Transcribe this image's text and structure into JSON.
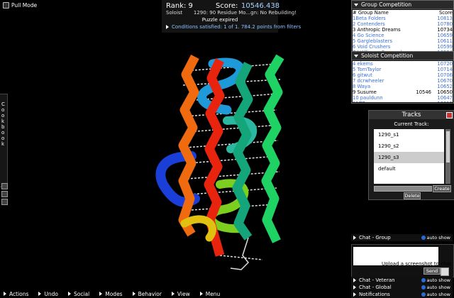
{
  "mode": {
    "label": "Pull Mode",
    "icon": "pull-mode-icon"
  },
  "header": {
    "rank_label": "Rank: 9",
    "score_label": "Score:",
    "score_value": "10546.438",
    "role": "Soloist",
    "puzzle": "1290: 90 Residue Mo...gn: No Rebuilding!",
    "status": "Puzzle expired",
    "conditions": "Conditions satisfied: 1 of 1. 784.2 points from filters"
  },
  "cookbook": {
    "label": "Cookbook"
  },
  "group_competition": {
    "title": "Group Competition",
    "col_name": "# Group Name",
    "col_score": "Score",
    "rows": [
      {
        "name": "1Beta Folders",
        "score": "10813",
        "me": false
      },
      {
        "name": "2 Contenders",
        "score": "10780",
        "me": false
      },
      {
        "name": "3 Anthropic Dreams",
        "score": "10734",
        "me": true
      },
      {
        "name": "4 Go Science",
        "score": "10659",
        "me": false
      },
      {
        "name": "5 Gargleblasters",
        "score": "10611",
        "me": false
      },
      {
        "name": "6 Void Crushers",
        "score": "10599",
        "me": false
      },
      {
        "name": "7 L'Alliance Francopho...",
        "score": "10534",
        "me": false
      }
    ]
  },
  "soloist_competition": {
    "title": "Soloist Competition",
    "rows": [
      {
        "name": "4 ekems",
        "mid": "",
        "score": "10720",
        "me": false
      },
      {
        "name": "5 TomTaylor",
        "mid": "",
        "score": "10714",
        "me": false
      },
      {
        "name": "6 gitwut",
        "mid": "",
        "score": "10706",
        "me": false
      },
      {
        "name": "7 dcrwheeler",
        "mid": "",
        "score": "10670",
        "me": false
      },
      {
        "name": "8 Waya",
        "mid": "",
        "score": "10652",
        "me": false
      },
      {
        "name": "9 Susume",
        "mid": "10546",
        "score": "10650",
        "me": true
      },
      {
        "name": "10 pauldunn",
        "mid": "",
        "score": "10647",
        "me": false
      },
      {
        "name": "11Z7ro",
        "mid": "",
        "score": "10612",
        "me": false
      },
      {
        "name": "12 phettles",
        "mid": "",
        "score": "10608",
        "me": false
      }
    ]
  },
  "tracks": {
    "title": "Tracks",
    "current_label": "Current Track:",
    "items": [
      "1290_s1",
      "1290_s2",
      "1290_s3",
      "default"
    ],
    "selected_index": 2,
    "create_label": "Create",
    "delete_label": "Delete"
  },
  "chat": {
    "group": {
      "label": "Chat - Group",
      "auto": "auto show"
    },
    "message": "Upload a screenshot to chat",
    "send_label": "Send",
    "veteran": {
      "label": "Chat - Veteran",
      "auto": "auto show"
    },
    "global": {
      "label": "Chat - Global",
      "auto": "auto show"
    },
    "notifications": {
      "label": "Notifications",
      "auto": "auto show"
    }
  },
  "bottom_menu": [
    "Actions",
    "Undo",
    "Social",
    "Modes",
    "Behavior",
    "View",
    "Menu"
  ],
  "colors": {
    "score": "#a9d3ff",
    "link": "#3a6fd0",
    "conditions": "#8fc2ff"
  }
}
